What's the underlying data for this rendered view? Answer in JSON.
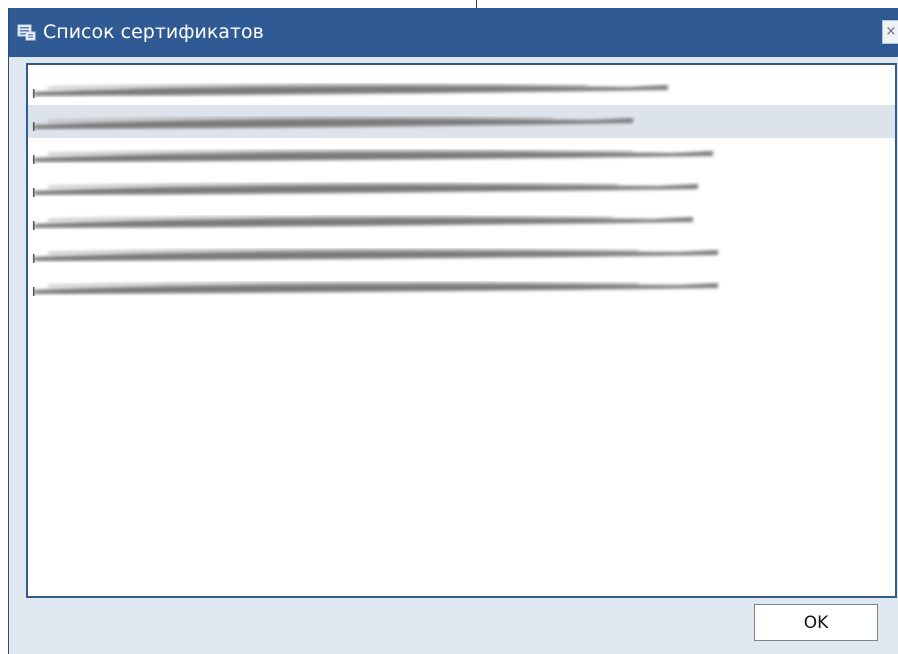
{
  "window": {
    "title": "Список сертификатов",
    "icon": "certificate-list-icon",
    "close_label": "×"
  },
  "certificate_list": {
    "selected_index": 1,
    "items": [
      {
        "label": ""
      },
      {
        "label": ""
      },
      {
        "label": ""
      },
      {
        "label": ""
      },
      {
        "label": ""
      },
      {
        "label": ""
      },
      {
        "label": ""
      }
    ]
  },
  "footer": {
    "ok_label": "OK"
  },
  "colors": {
    "titlebar": "#2f5a94",
    "dialog_background": "#dfe8f1",
    "selection": "#dde3ea",
    "frame_border": "#35598a"
  }
}
